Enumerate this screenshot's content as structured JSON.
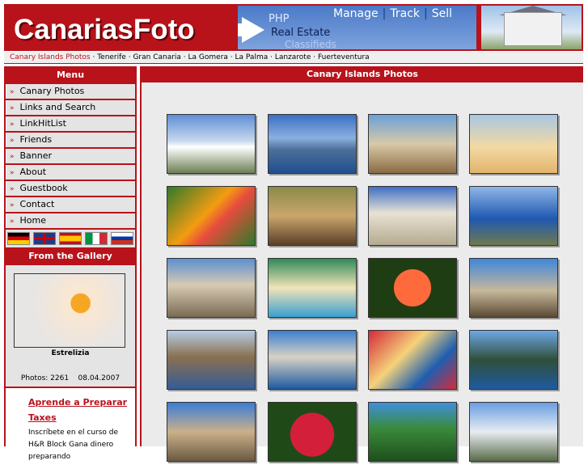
{
  "header": {
    "logo": "CanariasFoto",
    "banner_php": "PHP",
    "banner_real_estate": "Real Estate",
    "banner_classifieds": "Classifieds",
    "banner_links": [
      "Manage",
      "Track",
      "Sell"
    ]
  },
  "breadcrumb": {
    "first": "Canary Islands Photos",
    "items": [
      "Tenerife",
      "Gran Canaria",
      "La Gomera",
      "La Palma",
      "Lanzarote",
      "Fuerteventura"
    ]
  },
  "sidebar": {
    "menu_title": "Menu",
    "items": [
      {
        "label": "Canary Photos"
      },
      {
        "label": "Links and Search"
      },
      {
        "label": "LinkHitList"
      },
      {
        "label": "Friends"
      },
      {
        "label": "Banner"
      },
      {
        "label": "About"
      },
      {
        "label": "Guestbook"
      },
      {
        "label": "Contact"
      },
      {
        "label": "Home"
      }
    ],
    "flags": [
      "german-flag",
      "uk-flag",
      "spanish-flag",
      "italian-flag",
      "russian-flag"
    ],
    "gallery_title": "From the Gallery",
    "gallery_caption": "Estrelizia",
    "photos_label": "Photos: 2261",
    "date": "08.04.2007",
    "ad_link": "Aprende a Preparar Taxes",
    "ad_text": "Inscríbete en el curso de H&R Block Gana dinero preparando"
  },
  "main": {
    "title": "Canary Islands Photos",
    "thumbs": [
      "teide-view-photo",
      "harbor-town-photo",
      "castle-photo",
      "dunes-photo",
      "bird-of-paradise-photo",
      "flower-carpet-photo",
      "colonial-building-photo",
      "coastline-photo",
      "balconies-street-photo",
      "beach-crowd-photo",
      "hibiscus-photo",
      "rock-peak-photo",
      "sandy-bay-photo",
      "puerto-mogan-photo",
      "carnival-dancers-photo",
      "cliff-coast-photo",
      "cathedral-photo",
      "poinsettia-photo",
      "palm-garden-photo",
      "coast-town-photo"
    ]
  },
  "colors": {
    "brand_red": "#b8121b",
    "panel_grey": "#e4e4e4",
    "main_bg": "#ebebeb"
  }
}
